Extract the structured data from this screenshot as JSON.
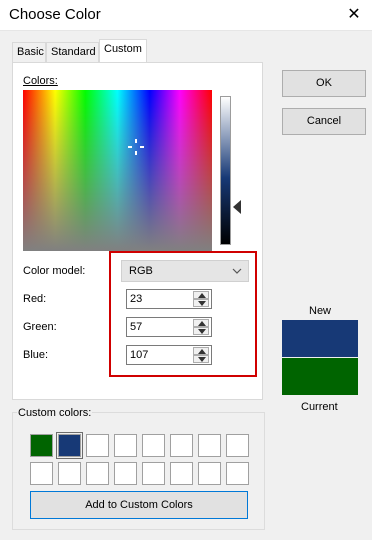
{
  "window": {
    "title": "Choose Color",
    "close_glyph": "✕"
  },
  "tabs": [
    {
      "label": "Basic",
      "active": false
    },
    {
      "label": "Standard",
      "active": false
    },
    {
      "label": "Custom",
      "active": true
    }
  ],
  "colors_label": "Colors:",
  "color_model": {
    "label": "Color model:",
    "value": "RGB"
  },
  "channels": {
    "red": {
      "label": "Red:",
      "value": "23"
    },
    "green": {
      "label": "Green:",
      "value": "57"
    },
    "blue": {
      "label": "Blue:",
      "value": "107"
    }
  },
  "buttons": {
    "ok": "OK",
    "cancel": "Cancel",
    "add": "Add to Custom Colors"
  },
  "preview": {
    "new_label": "New",
    "current_label": "Current",
    "new_color": "#173976",
    "current_color": "#006400"
  },
  "custom_colors": {
    "label": "Custom colors:",
    "cells": [
      "#006400",
      "#173976",
      "#ffffff",
      "#ffffff",
      "#ffffff",
      "#ffffff",
      "#ffffff",
      "#ffffff",
      "#ffffff",
      "#ffffff",
      "#ffffff",
      "#ffffff",
      "#ffffff",
      "#ffffff",
      "#ffffff",
      "#ffffff"
    ],
    "selected_index": 1
  },
  "accent": {
    "highlight": "#d00000",
    "focus": "#0078d7"
  }
}
